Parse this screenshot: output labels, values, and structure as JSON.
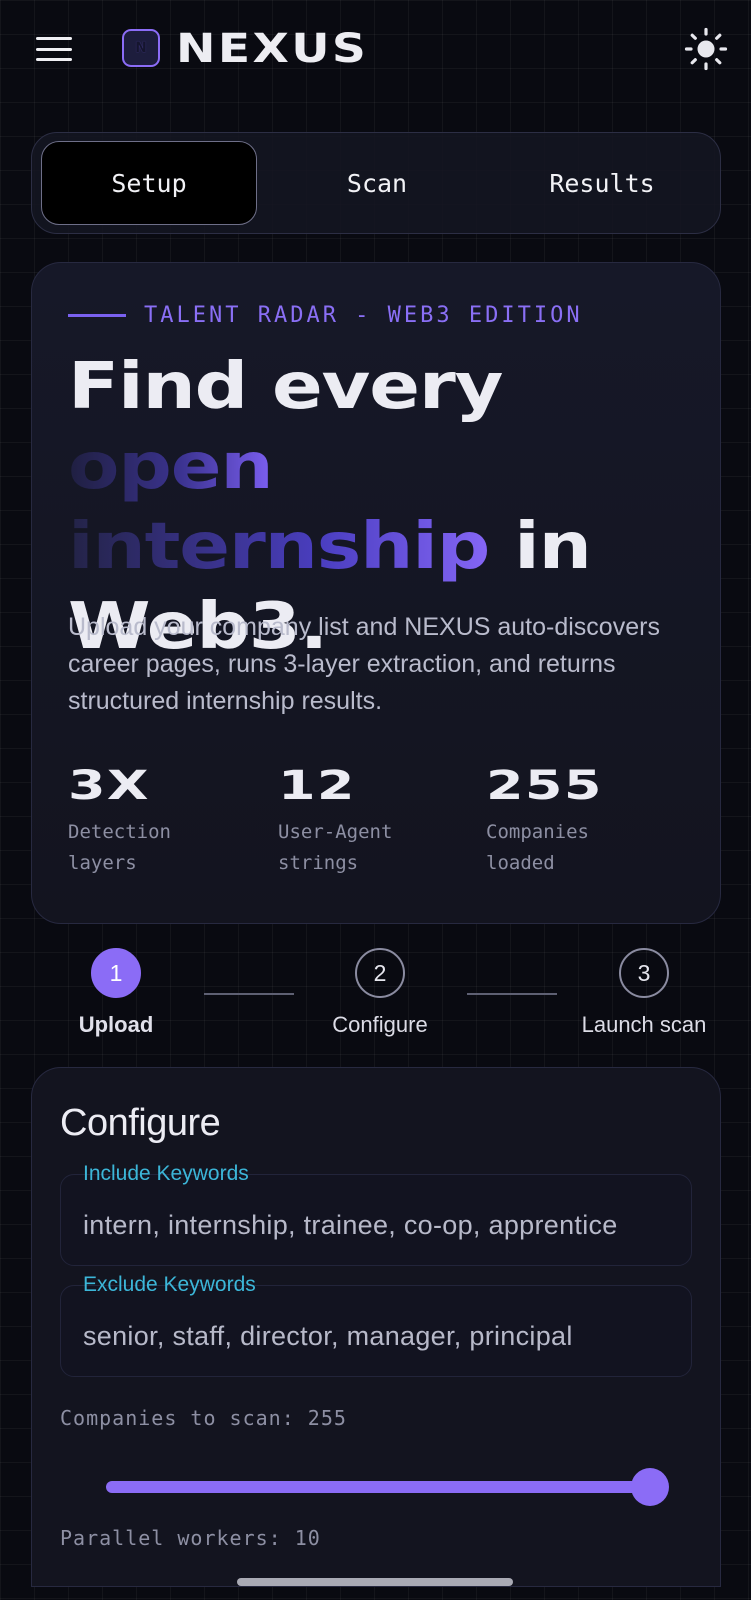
{
  "header": {
    "brand": "NEXUS",
    "logo_letter": "N",
    "menu_icon": "hamburger-menu-icon",
    "theme_icon": "sun-icon"
  },
  "tabs": [
    {
      "label": "Setup",
      "active": true
    },
    {
      "label": "Scan",
      "active": false
    },
    {
      "label": "Results",
      "active": false
    }
  ],
  "hero": {
    "eyebrow": "TALENT RADAR - WEB3 EDITION",
    "headline_line1": "Find every",
    "headline_line2": "open",
    "headline_line3_grad": "internship",
    "headline_line3_rest": " in",
    "headline_line4": "Web3.",
    "description": "Upload your company list and NEXUS auto-discovers career pages, runs 3-layer extraction, and returns structured internship results.",
    "stats": [
      {
        "value": "3X",
        "label": "Detection layers"
      },
      {
        "value": "12",
        "label": "User-Agent strings"
      },
      {
        "value": "255",
        "label": "Companies loaded"
      }
    ]
  },
  "stepper": {
    "steps": [
      {
        "number": "1",
        "label": "Upload",
        "active": true
      },
      {
        "number": "2",
        "label": "Configure",
        "active": false
      },
      {
        "number": "3",
        "label": "Launch scan",
        "active": false
      }
    ]
  },
  "configure": {
    "title": "Configure",
    "include_label": "Include Keywords",
    "include_value": "intern, internship, trainee, co-op, apprentice",
    "exclude_label": "Exclude Keywords",
    "exclude_value": "senior, staff, director, manager, principal",
    "companies_label": "Companies to scan: 255",
    "companies_slider_fraction": 1.0,
    "workers_label": "Parallel workers: 10"
  },
  "colors": {
    "accent": "#8b6cf6",
    "field_label": "#3cb6d8",
    "background": "#090a11"
  }
}
